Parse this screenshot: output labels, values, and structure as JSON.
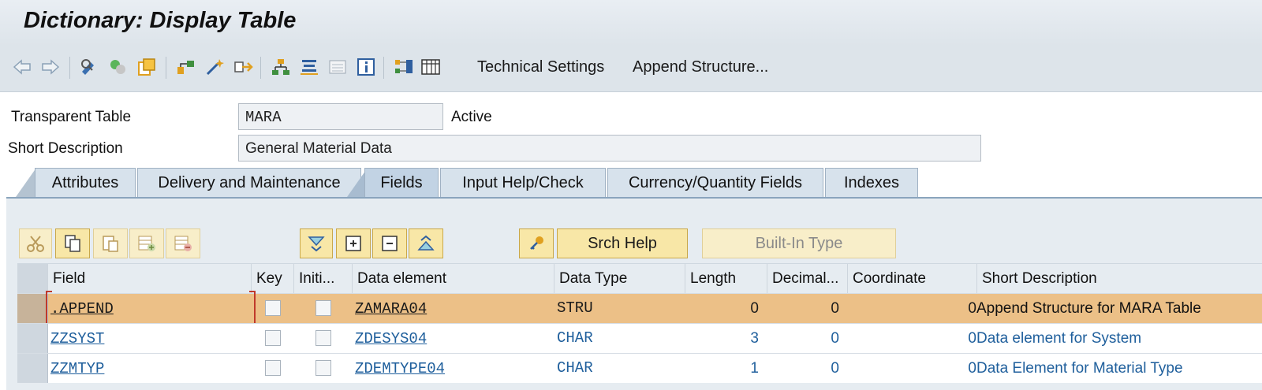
{
  "window": {
    "title": "Dictionary: Display Table"
  },
  "toolbar": {
    "icons": [
      "back-arrow-icon",
      "forward-arrow-icon",
      "display-change-icon",
      "activate-icon",
      "other-object-icon",
      "where-used-icon",
      "magic-wand-icon",
      "navigation-icon",
      "hierarchy-icon",
      "align-icon",
      "list-icon",
      "info-icon",
      "graphic-icon",
      "table-grid-icon"
    ],
    "technical_settings": "Technical Settings",
    "append_structure": "Append Structure..."
  },
  "form": {
    "table_type_label": "Transparent Table",
    "table_name": "MARA",
    "status": "Active",
    "short_desc_label": "Short Description",
    "short_desc": "General Material Data"
  },
  "tabs": [
    {
      "label": "Attributes",
      "active": false
    },
    {
      "label": "Delivery and Maintenance",
      "active": false
    },
    {
      "label": "Fields",
      "active": true
    },
    {
      "label": "Input Help/Check",
      "active": false
    },
    {
      "label": "Currency/Quantity Fields",
      "active": false
    },
    {
      "label": "Indexes",
      "active": false
    }
  ],
  "table_toolbar": {
    "srch_help": "Srch Help",
    "built_in_type": "Built-In Type"
  },
  "grid": {
    "columns": [
      "Field",
      "Key",
      "Initi...",
      "Data element",
      "Data Type",
      "Length",
      "Decimal...",
      "Coordinate",
      "Short Description"
    ],
    "rows": [
      {
        "field": ".APPEND",
        "key": false,
        "initial": false,
        "data_element": "ZAMARA04",
        "data_type": "STRU",
        "length": "0",
        "decimals": "0",
        "coordinate": "0",
        "short_description": "Append Structure for MARA Table",
        "selected": true
      },
      {
        "field": "ZZSYST",
        "key": false,
        "initial": false,
        "data_element": "ZDESYS04",
        "data_type": "CHAR",
        "length": "3",
        "decimals": "0",
        "coordinate": "0",
        "short_description": "Data element for System",
        "selected": false
      },
      {
        "field": "ZZMTYP",
        "key": false,
        "initial": false,
        "data_element": "ZDEMTYPE04",
        "data_type": "CHAR",
        "length": "1",
        "decimals": "0",
        "coordinate": "0",
        "short_description": "Data Element for Material Type",
        "selected": false
      }
    ]
  },
  "colors": {
    "header_bg": "#dde4ea",
    "selected_row": "#ecc087",
    "link": "#1f5f9c",
    "button_yellow": "#f8e7a7"
  }
}
